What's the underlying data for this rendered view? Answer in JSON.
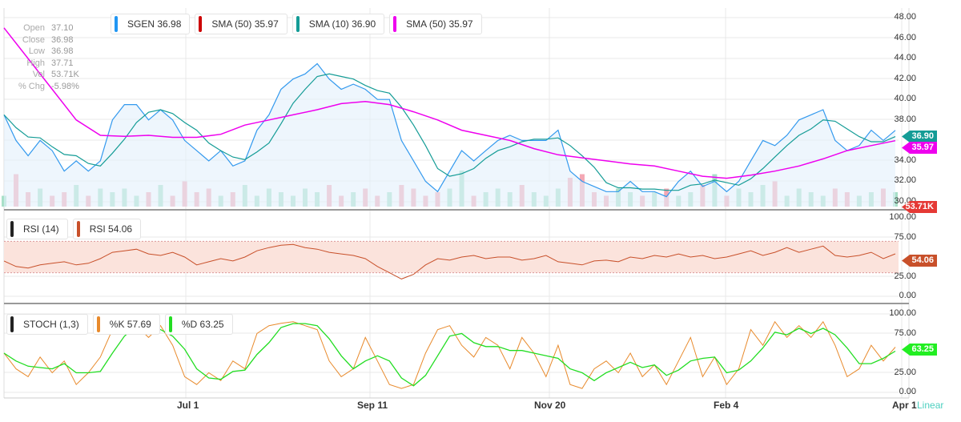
{
  "chart_data": {
    "type": "line",
    "title": "SGEN",
    "x_ticks": [
      "Jul 1",
      "Sep 11",
      "Nov 20",
      "Feb 4",
      "Apr 1"
    ],
    "scale_label": "Linear",
    "price_axis": {
      "ylim": [
        30,
        48
      ],
      "ticks": [
        "48.00",
        "46.00",
        "44.00",
        "42.00",
        "40.00",
        "38.00",
        "34.00",
        "32.00",
        "30.00"
      ]
    },
    "rsi_axis": {
      "ylim": [
        0,
        100
      ],
      "ticks": [
        "100.00",
        "75.00",
        "25.00",
        "0.00"
      ]
    },
    "stoch_axis": {
      "ylim": [
        0,
        100
      ],
      "ticks": [
        "100.00",
        "75.00",
        "25.00",
        "0.00"
      ]
    },
    "ohlc": [
      {
        "k": "Open",
        "v": "37.10"
      },
      {
        "k": "Close",
        "v": "36.98"
      },
      {
        "k": "Low",
        "v": "36.98"
      },
      {
        "k": "High",
        "v": "37.71"
      },
      {
        "k": "Vol",
        "v": "53.71K"
      },
      {
        "k": "% Chg",
        "v": "-5.98%"
      }
    ],
    "legend": [
      {
        "label": "SGEN 36.98",
        "color": "#2196f3"
      },
      {
        "label": "SMA (50) 35.97",
        "color": "#cc0000"
      },
      {
        "label": "SMA (10) 36.90",
        "color": "#149c96"
      },
      {
        "label": "SMA (50) 35.97",
        "color": "#ee00ee"
      }
    ],
    "rsi_legend": [
      {
        "label": "RSI (14)",
        "color": "#222222"
      },
      {
        "label": "RSI 54.06",
        "color": "#c8502a"
      }
    ],
    "stoch_legend": [
      {
        "label": "STOCH (1,3)",
        "color": "#222222"
      },
      {
        "label": "%K 57.69",
        "color": "#e88a2c"
      },
      {
        "label": "%D 63.25",
        "color": "#22dd22"
      }
    ],
    "tags": {
      "sma10": "36.90",
      "sma50": "35.97",
      "vol": "53.71K",
      "rsi": "54.06",
      "stoch": "63.25"
    },
    "price": [
      38.5,
      36,
      34.5,
      36,
      35,
      33,
      34,
      33,
      34,
      38,
      39.5,
      39.5,
      38,
      39,
      38,
      36,
      35,
      34,
      35,
      33.5,
      34,
      37,
      38.5,
      41,
      42,
      42.5,
      43.5,
      42,
      41,
      41.5,
      41,
      40,
      40,
      36,
      34,
      32,
      31,
      33,
      35,
      34,
      35,
      36,
      36.5,
      36,
      36,
      36,
      37,
      33,
      32,
      31.5,
      31,
      31,
      32,
      31,
      31,
      30.5,
      32,
      33,
      31.5,
      32,
      31,
      32,
      34,
      36,
      35.5,
      36.5,
      38,
      38.5,
      39,
      36,
      35,
      35.5,
      37,
      36,
      36.98
    ],
    "sma50": [
      47,
      44,
      41,
      38,
      36.5,
      36.4,
      36.5,
      36.3,
      36.3,
      36.6,
      37.5,
      38,
      38.5,
      39,
      39.6,
      39.8,
      39.5,
      38.8,
      38,
      37,
      36.5,
      36,
      35.2,
      34.6,
      34.3,
      34,
      33.7,
      33.5,
      33,
      32.5,
      32.3,
      32.6,
      33,
      33.5,
      34.2,
      35,
      35.5,
      35.97
    ],
    "volume": [
      3,
      9,
      4,
      5,
      3,
      4,
      6,
      3,
      5,
      4,
      5,
      3,
      4,
      6,
      3,
      7,
      4,
      5,
      3,
      4,
      6,
      3,
      5,
      4,
      3,
      5,
      4,
      6,
      3,
      4,
      5,
      3,
      4,
      6,
      5,
      3,
      4,
      5,
      10,
      3,
      4,
      5,
      4,
      6,
      4,
      3,
      5,
      8,
      9,
      4,
      3,
      5,
      4,
      3,
      4,
      5,
      3,
      4,
      6,
      9,
      3,
      5,
      4,
      6,
      7,
      3,
      5,
      4,
      3,
      5,
      4,
      3,
      4,
      5,
      4
    ],
    "rsi": [
      45,
      38,
      36,
      40,
      42,
      44,
      40,
      42,
      48,
      56,
      58,
      60,
      54,
      52,
      56,
      50,
      40,
      44,
      48,
      45,
      50,
      58,
      62,
      65,
      66,
      62,
      60,
      56,
      54,
      52,
      48,
      38,
      30,
      22,
      28,
      40,
      48,
      46,
      50,
      52,
      48,
      50,
      50,
      46,
      48,
      52,
      44,
      42,
      40,
      45,
      46,
      44,
      50,
      48,
      52,
      50,
      54,
      50,
      52,
      48,
      50,
      54,
      58,
      52,
      56,
      62,
      56,
      60,
      64,
      52,
      50,
      52,
      56,
      48,
      54.06
    ],
    "stoch_k": [
      50,
      30,
      20,
      45,
      25,
      40,
      10,
      25,
      45,
      80,
      90,
      85,
      70,
      85,
      60,
      20,
      10,
      25,
      15,
      40,
      30,
      75,
      85,
      88,
      90,
      85,
      80,
      40,
      20,
      30,
      70,
      40,
      10,
      5,
      10,
      50,
      80,
      85,
      60,
      45,
      70,
      60,
      30,
      70,
      50,
      20,
      60,
      10,
      5,
      30,
      40,
      25,
      50,
      20,
      35,
      10,
      40,
      70,
      20,
      45,
      10,
      30,
      80,
      60,
      90,
      70,
      85,
      70,
      90,
      60,
      20,
      30,
      60,
      40,
      57.69
    ]
  }
}
